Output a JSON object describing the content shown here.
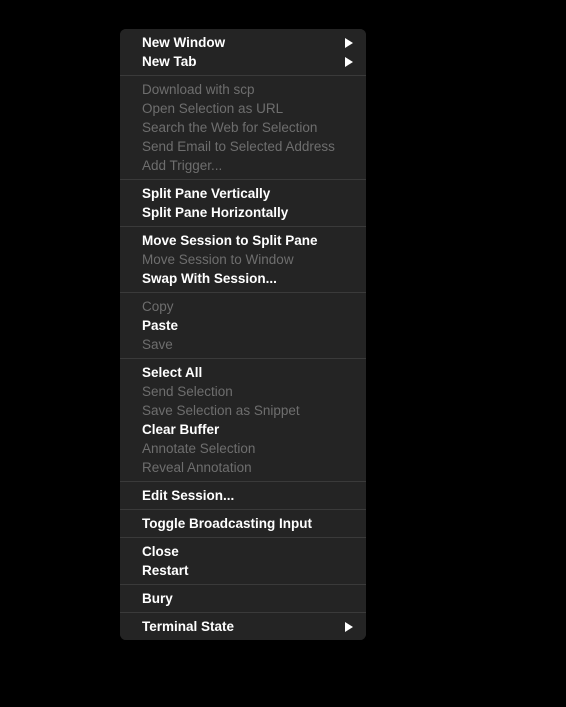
{
  "menu": {
    "name": "iterm-session-context-menu",
    "background_color": "#242424",
    "text_color": "#ffffff",
    "disabled_text_color": "#6e6e6e",
    "separator_color": "#3a3a3a",
    "submenu_arrow_icon": "caret-right-icon",
    "groups": [
      {
        "items": [
          {
            "label": "New Window",
            "enabled": true,
            "submenu": true
          },
          {
            "label": "New Tab",
            "enabled": true,
            "submenu": true
          }
        ]
      },
      {
        "items": [
          {
            "label": "Download with scp",
            "enabled": false,
            "submenu": false
          },
          {
            "label": "Open Selection as URL",
            "enabled": false,
            "submenu": false
          },
          {
            "label": "Search the Web for Selection",
            "enabled": false,
            "submenu": false
          },
          {
            "label": "Send Email to Selected Address",
            "enabled": false,
            "submenu": false
          },
          {
            "label": "Add Trigger...",
            "enabled": false,
            "submenu": false
          }
        ]
      },
      {
        "items": [
          {
            "label": "Split Pane Vertically",
            "enabled": true,
            "submenu": false
          },
          {
            "label": "Split Pane Horizontally",
            "enabled": true,
            "submenu": false
          }
        ]
      },
      {
        "items": [
          {
            "label": "Move Session to Split Pane",
            "enabled": true,
            "submenu": false
          },
          {
            "label": "Move Session to Window",
            "enabled": false,
            "submenu": false
          },
          {
            "label": "Swap With Session...",
            "enabled": true,
            "submenu": false
          }
        ]
      },
      {
        "items": [
          {
            "label": "Copy",
            "enabled": false,
            "submenu": false
          },
          {
            "label": "Paste",
            "enabled": true,
            "submenu": false
          },
          {
            "label": "Save",
            "enabled": false,
            "submenu": false
          }
        ]
      },
      {
        "items": [
          {
            "label": "Select All",
            "enabled": true,
            "submenu": false
          },
          {
            "label": "Send Selection",
            "enabled": false,
            "submenu": false
          },
          {
            "label": "Save Selection as Snippet",
            "enabled": false,
            "submenu": false
          },
          {
            "label": "Clear Buffer",
            "enabled": true,
            "submenu": false
          },
          {
            "label": "Annotate Selection",
            "enabled": false,
            "submenu": false
          },
          {
            "label": "Reveal Annotation",
            "enabled": false,
            "submenu": false
          }
        ]
      },
      {
        "items": [
          {
            "label": "Edit Session...",
            "enabled": true,
            "submenu": false
          }
        ]
      },
      {
        "items": [
          {
            "label": "Toggle Broadcasting Input",
            "enabled": true,
            "submenu": false
          }
        ]
      },
      {
        "items": [
          {
            "label": "Close",
            "enabled": true,
            "submenu": false
          },
          {
            "label": "Restart",
            "enabled": true,
            "submenu": false
          }
        ]
      },
      {
        "items": [
          {
            "label": "Bury",
            "enabled": true,
            "submenu": false
          }
        ]
      },
      {
        "items": [
          {
            "label": "Terminal State",
            "enabled": true,
            "submenu": true
          }
        ]
      }
    ]
  }
}
